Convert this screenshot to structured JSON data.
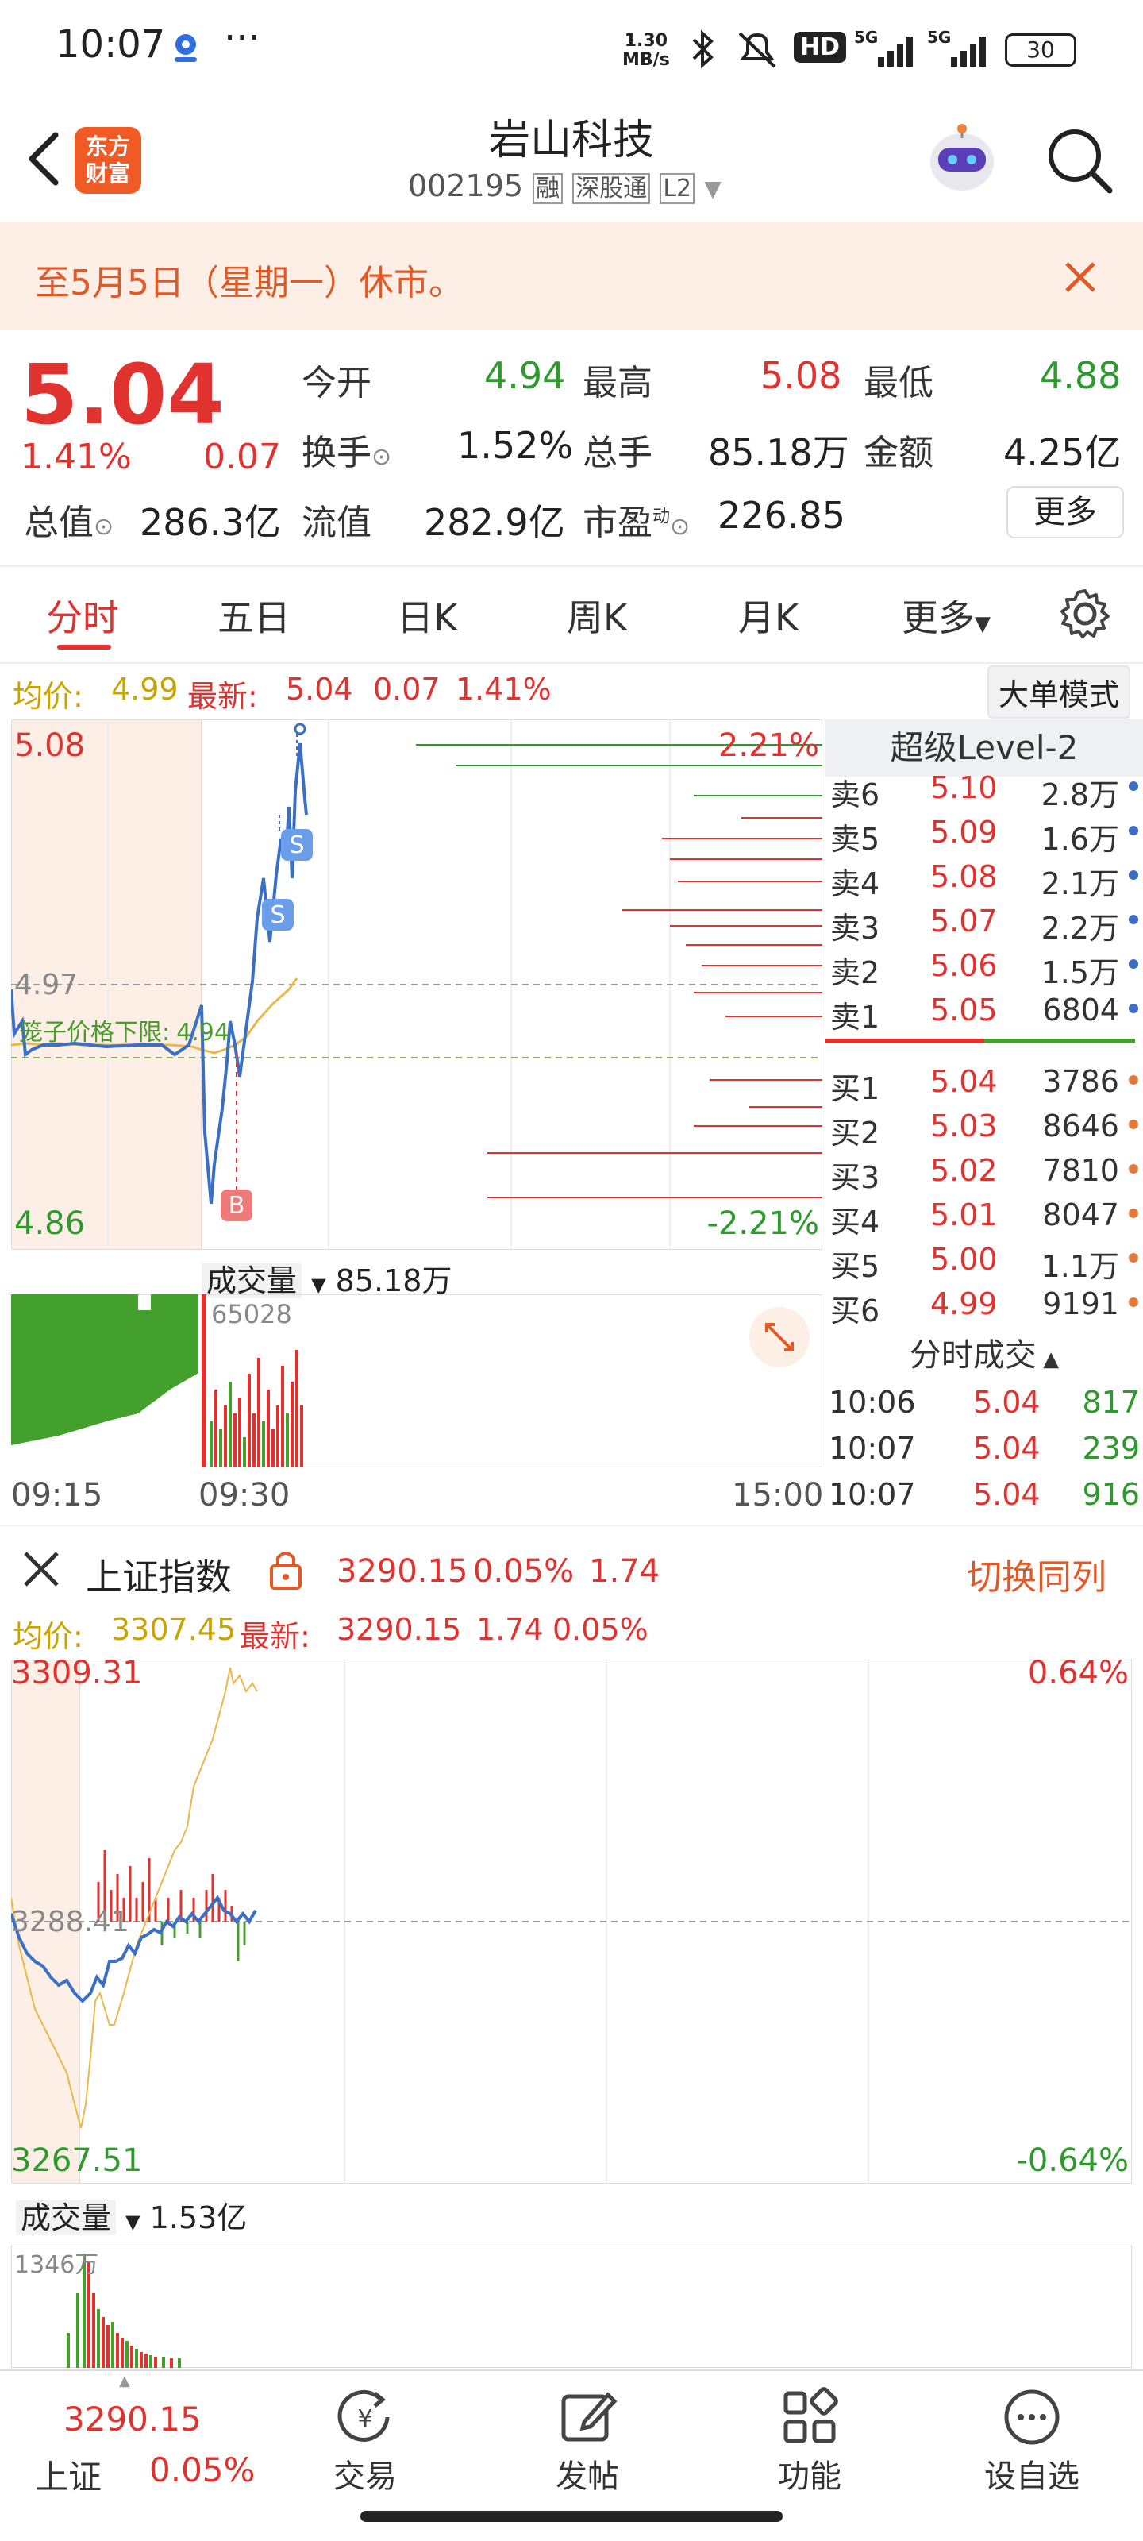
{
  "status": {
    "time": "10:07",
    "net_speed_top": "1.30",
    "net_speed_unit": "MB/s",
    "hd": "HD",
    "net1": "5G",
    "net2": "5G",
    "battery": "30"
  },
  "header": {
    "logo_line1": "东方",
    "logo_line2": "财富",
    "name": "岩山科技",
    "code": "002195",
    "tag_margin": "融",
    "tag_connect": "深股通",
    "tag_level": "L2"
  },
  "notice": {
    "text": "至5月5日（星期一）休市。"
  },
  "quote": {
    "price": "5.04",
    "change_pct": "1.41%",
    "change": "0.07",
    "open_label": "今开",
    "open": "4.94",
    "high_label": "最高",
    "high": "5.08",
    "low_label": "最低",
    "low": "4.88",
    "turnover_label": "换手",
    "turnover": "1.52%",
    "volume_label": "总手",
    "volume": "85.18万",
    "amount_label": "金额",
    "amount": "4.25亿",
    "mcap_label": "总值",
    "mcap": "286.3亿",
    "float_label": "流值",
    "float": "282.9亿",
    "pe_label": "市盈",
    "pe_sup": "动",
    "pe": "226.85",
    "more": "更多"
  },
  "tabs": [
    "分时",
    "五日",
    "日K",
    "周K",
    "月K",
    "更多"
  ],
  "stock_info": {
    "avg_label": "均价:",
    "avg": "4.99",
    "latest_label": "最新:",
    "latest": "5.04",
    "chg": "0.07",
    "pct": "1.41%",
    "big_order": "大单模式"
  },
  "stock_chart": {
    "y_high": "5.08",
    "y_low": "4.86",
    "y_mid": "4.97",
    "pct_high": "2.21%",
    "pct_low": "-2.21%",
    "limit_label": "笼子价格下限:",
    "limit_value": "4.94",
    "marker_b": "B",
    "marker_s": "S"
  },
  "stock_volume": {
    "label": "成交量",
    "value": "85.18万",
    "peak": "65028"
  },
  "time_axis": [
    "09:15",
    "09:30",
    "15:00"
  ],
  "orderbook": {
    "title": "超级Level-2",
    "sell": [
      {
        "label": "卖6",
        "price": "5.10",
        "vol": "2.8万"
      },
      {
        "label": "卖5",
        "price": "5.09",
        "vol": "1.6万"
      },
      {
        "label": "卖4",
        "price": "5.08",
        "vol": "2.1万"
      },
      {
        "label": "卖3",
        "price": "5.07",
        "vol": "2.2万"
      },
      {
        "label": "卖2",
        "price": "5.06",
        "vol": "1.5万"
      },
      {
        "label": "卖1",
        "price": "5.05",
        "vol": "6804"
      }
    ],
    "buy": [
      {
        "label": "买1",
        "price": "5.04",
        "vol": "3786"
      },
      {
        "label": "买2",
        "price": "5.03",
        "vol": "8646"
      },
      {
        "label": "买3",
        "price": "5.02",
        "vol": "7810"
      },
      {
        "label": "买4",
        "price": "5.01",
        "vol": "8047"
      },
      {
        "label": "买5",
        "price": "5.00",
        "vol": "1.1万"
      },
      {
        "label": "买6",
        "price": "4.99",
        "vol": "9191"
      }
    ],
    "trades_title": "分时成交",
    "trades": [
      {
        "time": "10:06",
        "price": "5.04",
        "vol": "817"
      },
      {
        "time": "10:07",
        "price": "5.04",
        "vol": "239"
      },
      {
        "time": "10:07",
        "price": "5.04",
        "vol": "916"
      }
    ]
  },
  "index": {
    "name": "上证指数",
    "value": "3290.15",
    "pct": "0.05%",
    "chg": "1.74",
    "switch": "切换同列",
    "avg_label": "均价:",
    "avg": "3307.45",
    "latest_label": "最新:",
    "latest": "3290.15",
    "y_high": "3309.31",
    "y_low": "3267.51",
    "y_mid": "3288.41",
    "pct_high": "0.64%",
    "pct_low": "-0.64%",
    "vol_label": "成交量",
    "vol_value": "1.53亿",
    "vol_peak": "1346万"
  },
  "bottom_nav": {
    "index_value": "3290.15",
    "index_name": "上证",
    "index_pct": "0.05%",
    "items": [
      "交易",
      "发帖",
      "功能",
      "设自选"
    ]
  },
  "colors": {
    "up": "#e0322e",
    "down": "#2e9a2e",
    "price_line": "#3a6fc4",
    "avg_line": "#e8b84a",
    "notice_bg": "#fdeee6"
  }
}
